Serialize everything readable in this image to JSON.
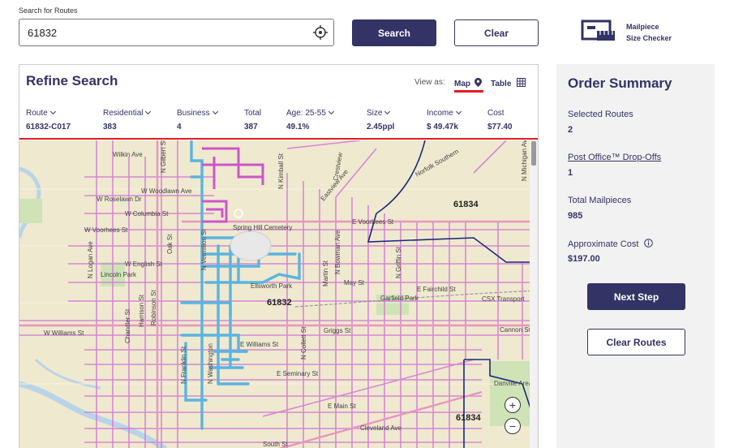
{
  "search": {
    "label": "Search for Routes",
    "value": "61832",
    "search_label": "Search",
    "clear_label": "Clear"
  },
  "checker": {
    "line1": "Mailpiece",
    "line2": "Size Checker",
    "icon": "mailpiece-ruler-icon"
  },
  "refine": {
    "title": "Refine Search",
    "view_as": "View as:",
    "map_label": "Map",
    "table_label": "Table",
    "columns": [
      {
        "label": "Route",
        "value": "61832-C017"
      },
      {
        "label": "Residential",
        "value": "383"
      },
      {
        "label": "Business",
        "value": "4"
      },
      {
        "label": "Total",
        "value": "387"
      },
      {
        "label": "Age: 25-55",
        "value": "49.1%"
      },
      {
        "label": "Size",
        "value": "2.45ppl"
      },
      {
        "label": "Income",
        "value": "$ 49.47k"
      },
      {
        "label": "Cost",
        "value": "$77.40"
      }
    ]
  },
  "map": {
    "zip_labels": [
      "61834",
      "61832",
      "61834"
    ],
    "road_labels": [
      "Wilkin Ave",
      "W Roselawn Dr",
      "W Woodlawn Ave",
      "W Columbia St",
      "W Voorhees St",
      "W English St",
      "E Voorhees St",
      "May St",
      "E Fairchild St",
      "Griggs St",
      "E Williams St",
      "E Seminary St",
      "W Williams St",
      "E Main St",
      "Cannon St",
      "Cleveland Ave",
      "South St",
      "Garfield Park",
      "Spring Hill Cemetery",
      "Lincoln Park",
      "Danville Area Community College",
      "N Logan Ave",
      "Oak St",
      "N Gilbert St",
      "N Vermilion St",
      "N Bowman Ave",
      "N Griffin St",
      "CSX Transport",
      "Ellsworth Park",
      "Crestview",
      "Eastview Ave",
      "N Kimball St",
      "Harrison St",
      "Robinson St",
      "Chandler St",
      "N Collett St",
      "N Franklin St",
      "N Washington",
      "Martin St",
      "N Michigan Ave",
      "Norfolk Southern"
    ],
    "zoom_in": "+",
    "zoom_out": "−"
  },
  "summary": {
    "title": "Order Summary",
    "selected_routes_label": "Selected Routes",
    "selected_routes_value": "2",
    "po_dropoffs_label": "Post Office™ Drop-Offs",
    "po_dropoffs_value": "1",
    "total_mailpieces_label": "Total Mailpieces",
    "total_mailpieces_value": "985",
    "approx_cost_label": "Approximate Cost",
    "approx_cost_value": "$197.00",
    "next_step_label": "Next Step",
    "clear_routes_label": "Clear Routes"
  },
  "colors": {
    "brand": "#333366",
    "accent_red": "#e31c23",
    "route_selected": "#5ab4e0",
    "route_other": "#d277d6",
    "map_bg": "#efe9cf"
  }
}
